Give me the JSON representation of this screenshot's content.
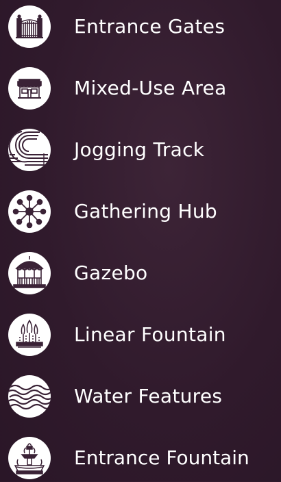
{
  "items": [
    {
      "label": "Entrance Gates",
      "icon": "entrance-gates-icon"
    },
    {
      "label": "Mixed-Use Area",
      "icon": "storefront-icon"
    },
    {
      "label": "Jogging Track",
      "icon": "jogging-track-icon"
    },
    {
      "label": "Gathering Hub",
      "icon": "network-hub-icon"
    },
    {
      "label": "Gazebo",
      "icon": "gazebo-icon"
    },
    {
      "label": "Linear Fountain",
      "icon": "linear-fountain-icon"
    },
    {
      "label": "Water Features",
      "icon": "water-waves-icon"
    },
    {
      "label": "Entrance Fountain",
      "icon": "tiered-fountain-icon"
    }
  ],
  "colors": {
    "background": "#301a2c",
    "icon_fill": "#3a2236",
    "icon_bg": "#ffffff",
    "text": "#ffffff"
  }
}
